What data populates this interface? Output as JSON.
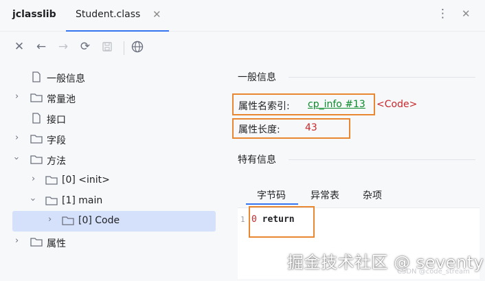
{
  "app": {
    "name": "jclasslib"
  },
  "tabs": [
    {
      "label": "Student.class",
      "active": true
    }
  ],
  "toolbar": {
    "icons": [
      "close-icon",
      "back-icon",
      "forward-icon",
      "refresh-icon",
      "save-icon",
      "browser-icon"
    ]
  },
  "tree": {
    "items": [
      {
        "label": "一般信息",
        "type": "file",
        "depth": 0
      },
      {
        "label": "常量池",
        "type": "folder",
        "depth": 0,
        "expanded": false
      },
      {
        "label": "接口",
        "type": "file",
        "depth": 0
      },
      {
        "label": "字段",
        "type": "folder",
        "depth": 0,
        "expanded": false
      },
      {
        "label": "方法",
        "type": "folder",
        "depth": 0,
        "expanded": true
      },
      {
        "label": "[0] <init>",
        "type": "folder",
        "depth": 1,
        "expanded": false
      },
      {
        "label": "[1] main",
        "type": "folder",
        "depth": 1,
        "expanded": true
      },
      {
        "label": "[0] Code",
        "type": "folder",
        "depth": 2,
        "expanded": false,
        "selected": true
      },
      {
        "label": "属性",
        "type": "folder",
        "depth": 0,
        "expanded": false
      }
    ]
  },
  "detail": {
    "general_title": "一般信息",
    "name_index_label": "属性名索引:",
    "name_index_value": "cp_info #13",
    "name_index_comment": "<Code>",
    "length_label": "属性长度:",
    "length_value": "43",
    "specific_title": "特有信息",
    "subtabs": [
      {
        "label": "字节码",
        "active": true
      },
      {
        "label": "异常表"
      },
      {
        "label": "杂项"
      }
    ],
    "code": {
      "line_number": "1",
      "offset": "0",
      "instruction": "return"
    }
  },
  "watermark": "掘金技术社区 @ seventy",
  "csdn_mark": "CSDN @code_stream",
  "colors": {
    "accent": "#3574f0",
    "highlight_box": "#e8872f",
    "link_green": "#098a2a",
    "value_red": "#c7272b",
    "selection": "#d5e1fb"
  }
}
